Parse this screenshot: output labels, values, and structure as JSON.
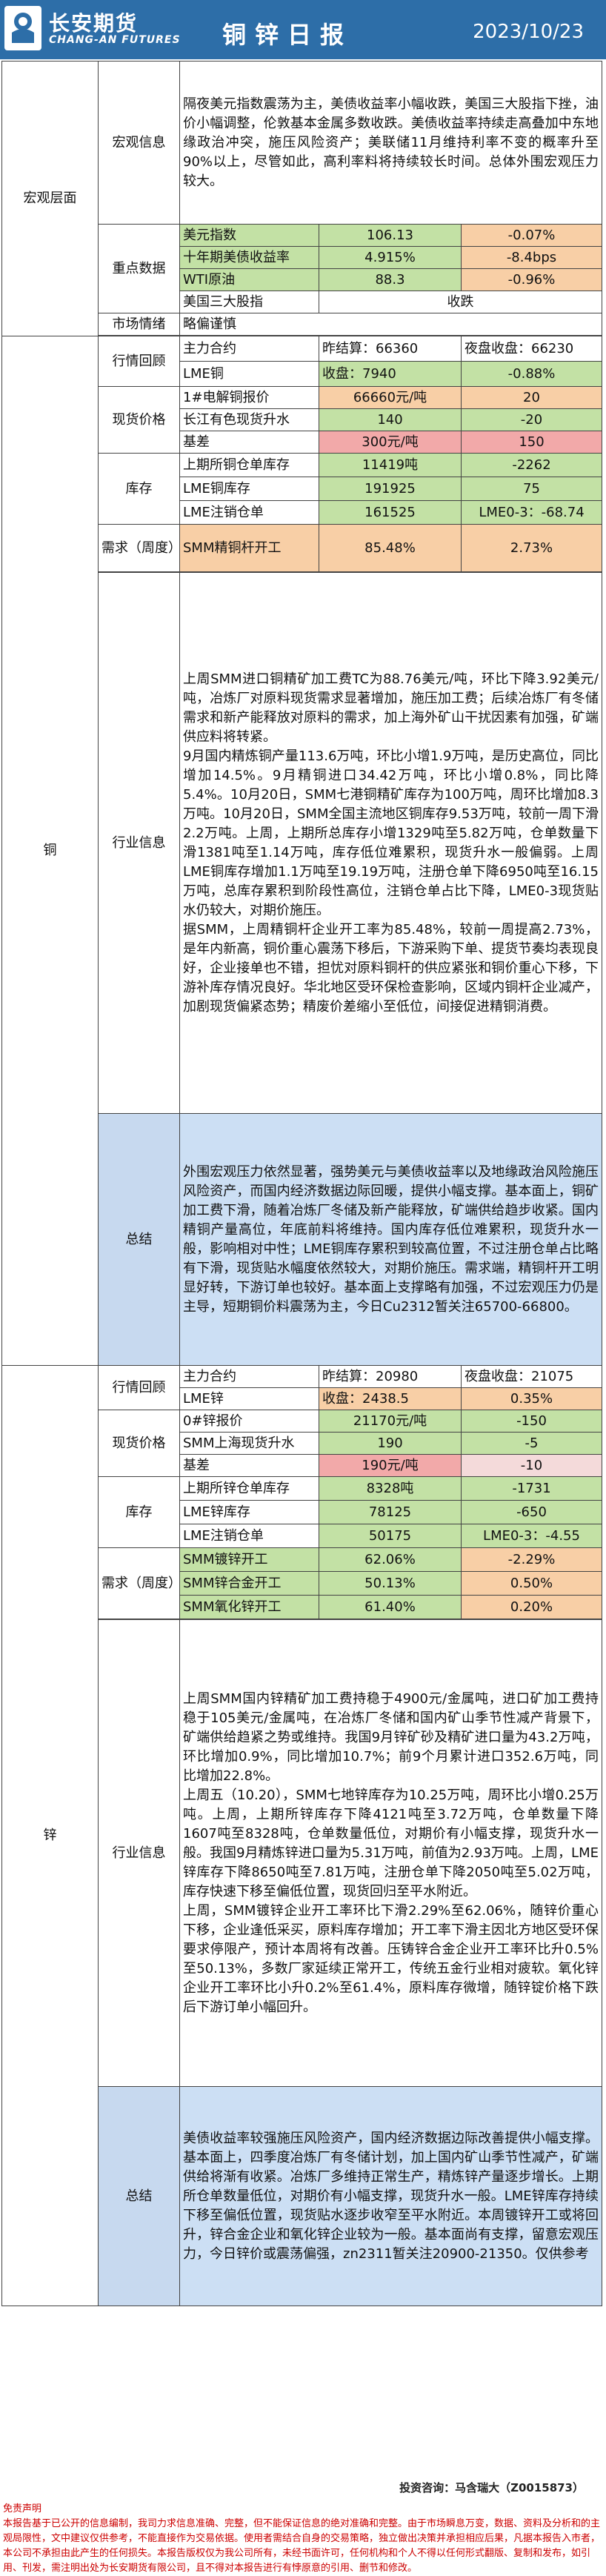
{
  "header": {
    "brand_cn": "长安期货",
    "brand_en": "CHANG-AN FUTURES",
    "title": "铜锌日报",
    "date": "2023/10/23"
  },
  "macro": {
    "section": "宏观层面",
    "info_label": "宏观信息",
    "info_text": "隔夜美元指数震荡为主，美债收益率小幅收跌，美国三大股指下挫，油价小幅调整，伦敦基本金属多数收跌。美债收益率持续走高叠加中东地缘政治冲突，施压风险资产；美联储11月维持利率不变的概率升至90%以上，尽管如此，高利率料将持续较长时间。总体外围宏观压力较大。",
    "key_label": "重点数据",
    "key_rows": [
      {
        "name": "美元指数",
        "value": "106.13",
        "change": "-0.07%"
      },
      {
        "name": "十年期美债收益率",
        "value": "4.915%",
        "change": "-8.4bps"
      },
      {
        "name": "WTI原油",
        "value": "88.3",
        "change": "-0.96%"
      },
      {
        "name": "美国三大股指",
        "value": "收跌",
        "change": ""
      }
    ],
    "mood_label": "市场情绪",
    "mood_value": "略偏谨慎"
  },
  "copper": {
    "section": "铜",
    "review_label": "行情回顾",
    "contract_label": "主力合约",
    "prev_settle": "昨结算：66360",
    "night_close": "夜盘收盘：66230",
    "lme_label": "LME铜",
    "lme_close": "收盘：7940",
    "lme_change": "-0.88%",
    "spot_label": "现货价格",
    "spot_rows": [
      {
        "name": "1#电解铜报价",
        "value": "66660元/吨",
        "change": "20"
      },
      {
        "name": "长江有色现货升水",
        "value": "140",
        "change": "-20"
      },
      {
        "name": "基差",
        "value": "300元/吨",
        "change": "150"
      }
    ],
    "stock_label": "库存",
    "stock_rows": [
      {
        "name": "上期所铜仓单库存",
        "value": "11419吨",
        "change": "-2262"
      },
      {
        "name": "LME铜库存",
        "value": "191925",
        "change": "75"
      },
      {
        "name": "LME注销仓单",
        "value": "161525",
        "change": "LME0-3：-68.74"
      }
    ],
    "demand_label": "需求（周度）",
    "demand_rows": [
      {
        "name": "SMM精铜杆开工",
        "value": "85.48%",
        "change": "2.73%"
      }
    ],
    "industry_label": "行业信息",
    "industry_paragraphs": [
      "上周SMM进口铜精矿加工费TC为88.76美元/吨，环比下降3.92美元/吨，冶炼厂对原料现货需求显著增加，施压加工费；后续冶炼厂有冬储需求和新产能释放对原料的需求，加上海外矿山干扰因素有加强，矿端供应料将转紧。",
      "9月国内精炼铜产量113.6万吨，环比小增1.9万吨，是历史高位，同比增加14.5%。9月精铜进口34.42万吨，环比小增0.8%，同比降5.4%。10月20日，SMM七港铜精矿库存为100万吨，周环比增加8.3万吨。10月20日，SMM全国主流地区铜库存9.53万吨，较前一周下滑2.2万吨。上周，上期所总库存小增1329吨至5.82万吨，仓单数量下滑1381吨至1.14万吨，库存低位难累积，现货升水一般偏弱。上周LME铜库存增加1.1万吨至19.19万吨，注册仓单下降6950吨至16.15万吨，总库存累积到阶段性高位，注销仓单占比下降，LME0-3现货贴水仍较大，对期价施压。",
      "据SMM，上周精铜杆企业开工率为85.48%，较前一周提高2.73%，是年内新高，铜价重心震荡下移后，下游采购下单、提货节奏均表现良好，企业接单也不错，担忧对原料铜杆的供应紧张和铜价重心下移，下游补库存情况良好。华北地区受环保检查影响，区域内铜杆企业减产，加剧现货偏紧态势；精废价差缩小至低位，间接促进精铜消费。"
    ],
    "summary_label": "总结",
    "summary_text": "外围宏观压力依然显著，强势美元与美债收益率以及地缘政治风险施压风险资产，而国内经济数据边际回暖，提供小幅支撑。基本面上，铜矿加工费下滑，随着冶炼厂冬储及新产能释放，矿端供给趋步收紧。国内精铜产量高位，年底前料将维持。国内库存低位难累积，现货升水一般，影响相对中性；LME铜库存累积到较高位置，不过注册仓单占比略有下滑，现货贴水幅度依然较大，对期价施压。需求端，精铜杆开工明显好转，下游订单也较好。基本面上支撑略有加强，不过宏观压力仍是主导，短期铜价料震荡为主，今日Cu2312暂关注65700-66800。"
  },
  "zinc": {
    "section": "锌",
    "review_label": "行情回顾",
    "contract_label": "主力合约",
    "prev_settle": "昨结算：20980",
    "night_close": "夜盘收盘：21075",
    "lme_label": "LME锌",
    "lme_close": "收盘：2438.5",
    "lme_change": "0.35%",
    "spot_label": "现货价格",
    "spot_rows": [
      {
        "name": "0#锌报价",
        "value": "21170元/吨",
        "change": "-150"
      },
      {
        "name": "SMM上海现货升水",
        "value": "190",
        "change": "-5"
      },
      {
        "name": "基差",
        "value": "190元/吨",
        "change": "-10"
      }
    ],
    "stock_label": "库存",
    "stock_rows": [
      {
        "name": "上期所锌仓单库存",
        "value": "8328吨",
        "change": "-1731"
      },
      {
        "name": "LME锌库存",
        "value": "78125",
        "change": "-650"
      },
      {
        "name": "LME注销仓单",
        "value": "50175",
        "change": "LME0-3：-4.55"
      }
    ],
    "demand_label": "需求（周度）",
    "demand_rows": [
      {
        "name": "SMM镀锌开工",
        "value": "62.06%",
        "change": "-2.29%"
      },
      {
        "name": "SMM锌合金开工",
        "value": "50.13%",
        "change": "0.50%"
      },
      {
        "name": "SMM氧化锌开工",
        "value": "61.40%",
        "change": "0.20%"
      }
    ],
    "industry_label": "行业信息",
    "industry_paragraphs": [
      "上周SMM国内锌精矿加工费持稳于4900元/金属吨，进口矿加工费持稳于105美元/金属吨，在冶炼厂冬储和国内矿山季节性减产背景下，矿端供给趋紧之势或维持。我国9月锌矿砂及精矿进口量为43.2万吨，环比增加0.9%，同比增加10.7%；前9个月累计进口352.6万吨，同比增加22.8%。",
      "上周五（10.20），SMM七地锌库存为10.25万吨，周环比小增0.25万吨。上周，上期所锌库存下降4121吨至3.72万吨，仓单数量下降1607吨至8328吨，仓单数量低位，对期价有小幅支撑，现货升水一般。我国9月精炼锌进口量为5.31万吨，前值为2.93万吨。上周，LME锌库存下降8650吨至7.81万吨，注册仓单下降2050吨至5.02万吨，库存快速下移至偏低位置，现货回归至平水附近。",
      "上周，SMM镀锌企业开工率环比下滑2.29%至62.06%，随锌价重心下移，企业逢低采买，原料库存增加；开工率下滑主因北方地区受环保要求停限产，预计本周将有改善。压铸锌合金企业开工率环比升0.5%至50.13%，多数厂家延续正常开工，传统五金行业相对疲软。氧化锌企业开工率环比小升0.2%至61.4%，原料库存微增，随锌锭价格下跌后下游订单小幅回升。"
    ],
    "summary_label": "总结",
    "summary_text": "美债收益率较强施压风险资产，国内经济数据边际改善提供小幅支撑。基本面上，四季度冶炼厂有冬储计划，加上国内矿山季节性减产，矿端供给将渐有收紧。冶炼厂多维持正常生产，精炼锌产量逐步增长。上期所仓单数量低位，对期价有小幅支撑，现货升水一般。LME锌库存持续下移至偏低位置，现货贴水逐步收窄至平水附近。本周镀锌开工或将回升，锌合金企业和氧化锌企业较为一般。基本面尚有支撑，留意宏观压力，今日锌价或震荡偏强，zn2311暂关注20900-21350。仅供参考"
  },
  "footer": {
    "analyst": "投资咨询：马含瑞大（Z0015873）",
    "disclaimer_title": "免责声明",
    "disclaimer_text": "本报告基于已公开的信息编制，我司力求信息准确、完整，但不能保证信息的绝对准确和完整。由于市场瞬息万变，数据、资料及分析和的主观局限性，文中建议仅供参考，不能直接作为交易依据。使用者需结合自身的交易策略，独立做出决策并承担相应后果，凡据本报告入市者，本公司不承担由此产生的任何损失。本报告版权仅为我公司所有，未经书面许可，任何机构和个人不得以任何形式翻版、复制和发布，如引用、刊发，需注明出处为长安期货有限公司，且不得对本报告进行有悖原意的引用、删节和修改。"
  }
}
